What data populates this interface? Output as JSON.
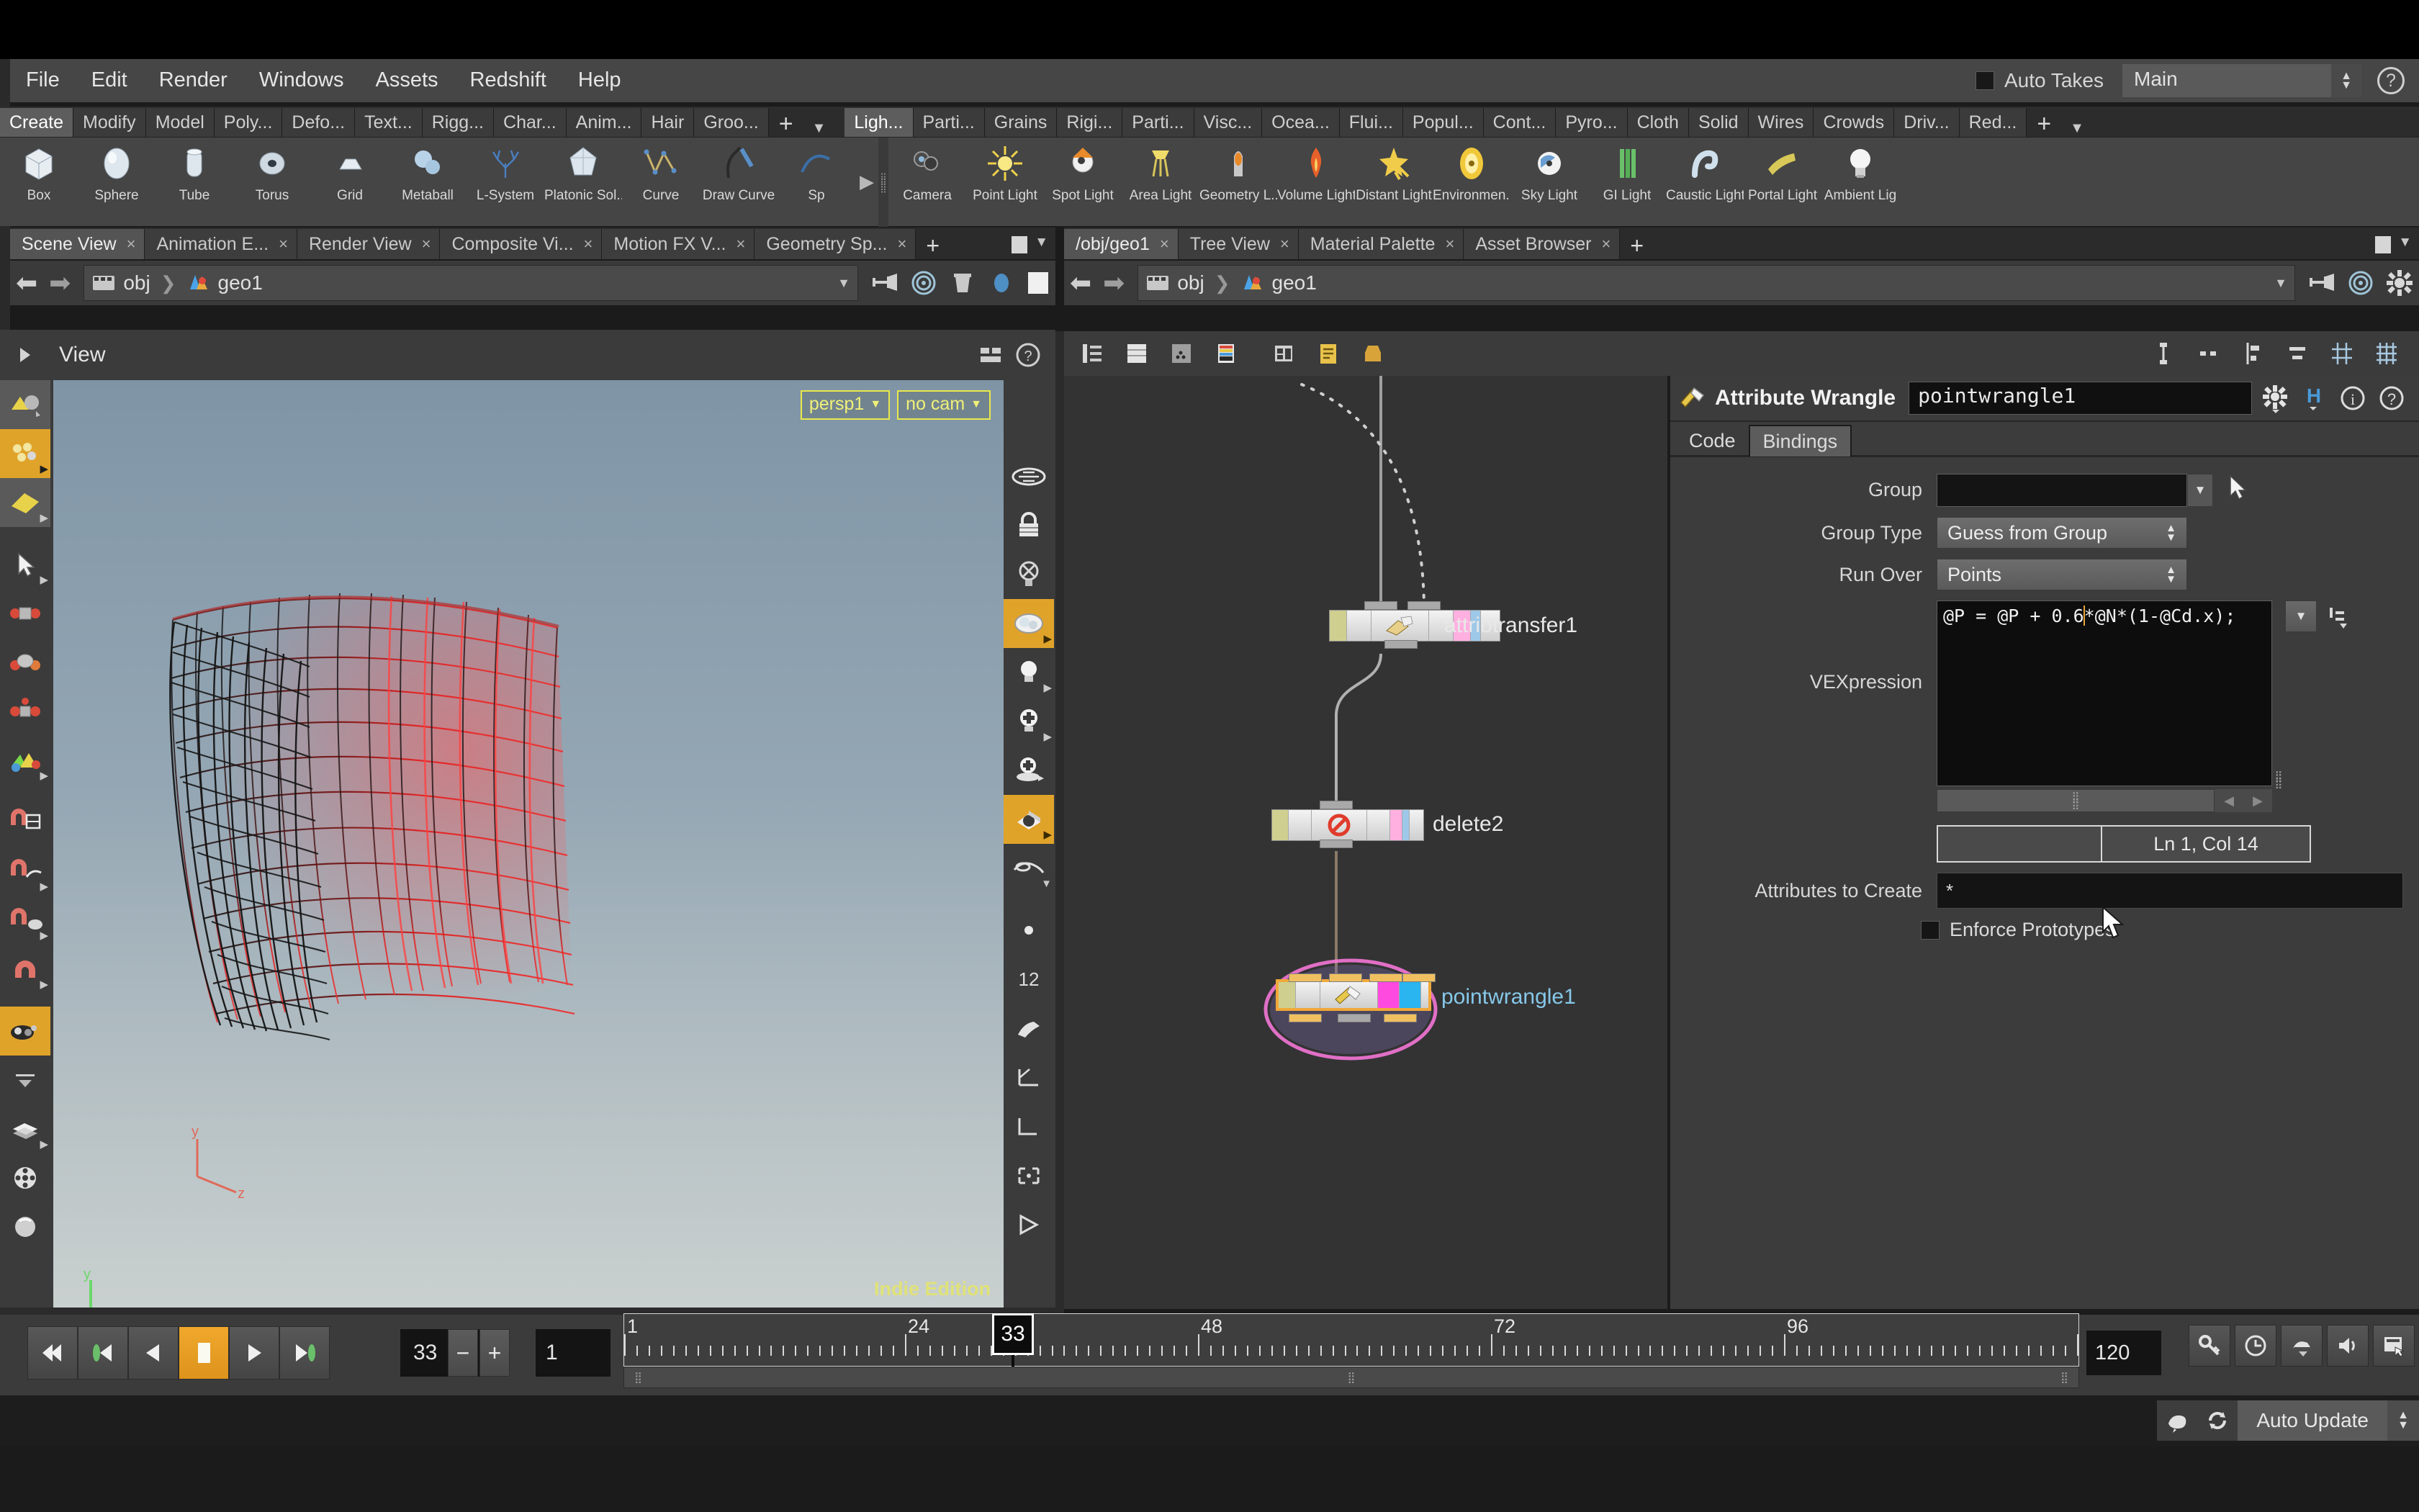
{
  "menubar": {
    "items": [
      "File",
      "Edit",
      "Render",
      "Windows",
      "Assets",
      "Redshift",
      "Help"
    ],
    "auto_takes_label": "Auto Takes",
    "take_value": "Main",
    "help_glyph": "?"
  },
  "shelf": {
    "left_tabs": [
      "Create",
      "Modify",
      "Model",
      "Poly...",
      "Defo...",
      "Text...",
      "Rigg...",
      "Char...",
      "Anim...",
      "Hair",
      "Groo..."
    ],
    "left_active": "Create",
    "right_tabs": [
      "Ligh...",
      "Parti...",
      "Grains",
      "Rigi...",
      "Parti...",
      "Visc...",
      "Ocea...",
      "Flui...",
      "Popul...",
      "Cont...",
      "Pyro...",
      "Cloth",
      "Solid",
      "Wires",
      "Crowds",
      "Driv...",
      "Red..."
    ],
    "right_active": "Ligh...",
    "plus_glyph": "+",
    "caret_glyph": "▼",
    "left_items": [
      {
        "label": "Box",
        "icon": "box-icon"
      },
      {
        "label": "Sphere",
        "icon": "sphere-icon"
      },
      {
        "label": "Tube",
        "icon": "tube-icon"
      },
      {
        "label": "Torus",
        "icon": "torus-icon"
      },
      {
        "label": "Grid",
        "icon": "grid-icon"
      },
      {
        "label": "Metaball",
        "icon": "metaball-icon"
      },
      {
        "label": "L-System",
        "icon": "lsystem-icon"
      },
      {
        "label": "Platonic Sol...",
        "icon": "platonic-solid-icon"
      },
      {
        "label": "Curve",
        "icon": "curve-icon"
      },
      {
        "label": "Draw Curve",
        "icon": "draw-curve-icon"
      },
      {
        "label": "Sp",
        "icon": "spline-icon"
      }
    ],
    "right_items": [
      {
        "label": "Camera",
        "icon": "camera-icon"
      },
      {
        "label": "Point Light",
        "icon": "point-light-icon"
      },
      {
        "label": "Spot Light",
        "icon": "spot-light-icon"
      },
      {
        "label": "Area Light",
        "icon": "area-light-icon"
      },
      {
        "label": "Geometry L...",
        "icon": "geometry-light-icon"
      },
      {
        "label": "Volume Light",
        "icon": "volume-light-icon"
      },
      {
        "label": "Distant Light",
        "icon": "distant-light-icon"
      },
      {
        "label": "Environmen...",
        "icon": "environment-light-icon"
      },
      {
        "label": "Sky Light",
        "icon": "sky-light-icon"
      },
      {
        "label": "GI Light",
        "icon": "gi-light-icon"
      },
      {
        "label": "Caustic Light",
        "icon": "caustic-light-icon"
      },
      {
        "label": "Portal Light",
        "icon": "portal-light-icon"
      },
      {
        "label": "Ambient Lig",
        "icon": "ambient-light-icon"
      }
    ]
  },
  "left_pane": {
    "tabs": [
      {
        "label": "Scene View",
        "active": true
      },
      {
        "label": "Animation E...",
        "active": false
      },
      {
        "label": "Render View",
        "active": false
      },
      {
        "label": "Composite Vi...",
        "active": false
      },
      {
        "label": "Motion FX V...",
        "active": false
      },
      {
        "label": "Geometry Sp...",
        "active": false
      }
    ],
    "path": {
      "root": "obj",
      "node": "geo1",
      "separator": "❯"
    },
    "viewport": {
      "title": "View",
      "camera_badge": "persp1",
      "cam_badge": "no cam",
      "watermark": "Indie Edition"
    }
  },
  "right_pane": {
    "tabs": [
      {
        "label": "/obj/geo1",
        "active": true
      },
      {
        "label": "Tree View",
        "active": false
      },
      {
        "label": "Material Palette",
        "active": false
      },
      {
        "label": "Asset Browser",
        "active": false
      }
    ],
    "path": {
      "root": "obj",
      "node": "geo1",
      "separator": "❯"
    },
    "network_nodes": [
      {
        "name": "attribtransfer1",
        "icon": "attribute-transfer-icon",
        "selected": false
      },
      {
        "name": "delete2",
        "icon": "delete-icon",
        "selected": false
      },
      {
        "name": "pointwrangle1",
        "icon": "wrangle-icon",
        "selected": true
      }
    ]
  },
  "params": {
    "title": "Attribute Wrangle",
    "node_name": "pointwrangle1",
    "tabs": [
      {
        "label": "Code",
        "active": false
      },
      {
        "label": "Bindings",
        "active": true
      }
    ],
    "group_label": "Group",
    "group_value": "",
    "group_type_label": "Group Type",
    "group_type_value": "Guess from Group",
    "run_over_label": "Run Over",
    "run_over_value": "Points",
    "vexpression_label": "VEXpression",
    "vexpression_before_cursor": "@P = @P + 0.6",
    "vexpression_after_cursor": "*@N*(1-@Cd.x);",
    "line_col": "Ln 1, Col 14",
    "attributes_label": "Attributes to Create",
    "attributes_value": "*",
    "enforce_label": "Enforce Prototypes"
  },
  "playbar": {
    "current_frame": "33",
    "increment": "1",
    "range_end": "120",
    "playhead_frame": "33",
    "transport": [
      {
        "name": "jump-to-start-button",
        "glyph": "skip-back"
      },
      {
        "name": "previous-key-button",
        "glyph": "prev-key"
      },
      {
        "name": "step-back-button",
        "glyph": "step-back"
      },
      {
        "name": "stop-button",
        "glyph": "stop"
      },
      {
        "name": "play-button",
        "glyph": "play"
      },
      {
        "name": "jump-to-end-button",
        "glyph": "skip-forward"
      }
    ],
    "minus": "−",
    "plus": "+",
    "ruler_labels": [
      "1",
      "24",
      "48",
      "72",
      "96",
      "1"
    ],
    "ruler_positions": [
      1,
      24,
      48,
      72,
      96,
      120
    ]
  },
  "status": {
    "auto_update_label": "Auto Update"
  }
}
